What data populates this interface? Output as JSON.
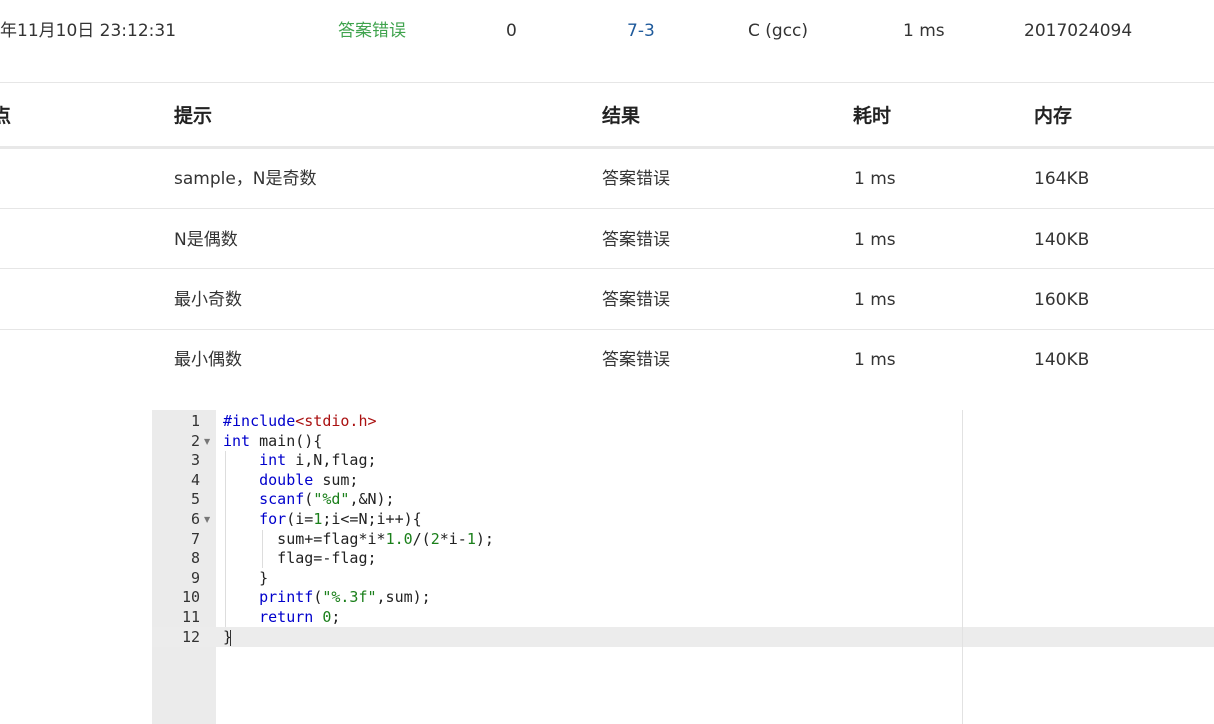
{
  "submission": {
    "time": "年11月10日 23:12:31",
    "status": "答案错误",
    "score": "0",
    "problem": "7-3",
    "compiler": "C (gcc)",
    "duration": "1 ms",
    "user": "2017024094"
  },
  "cases_table": {
    "headers": [
      "点",
      "提示",
      "结果",
      "耗时",
      "内存"
    ],
    "rows": [
      {
        "hint": "sample，N是奇数",
        "result": "答案错误",
        "time": "1 ms",
        "memory": "164KB"
      },
      {
        "hint": "N是偶数",
        "result": "答案错误",
        "time": "1 ms",
        "memory": "140KB"
      },
      {
        "hint": "最小奇数",
        "result": "答案错误",
        "time": "1 ms",
        "memory": "160KB"
      },
      {
        "hint": "最小偶数",
        "result": "答案错误",
        "time": "1 ms",
        "memory": "140KB"
      }
    ]
  },
  "editor": {
    "line_numbers": [
      "1",
      "2",
      "3",
      "4",
      "5",
      "6",
      "7",
      "8",
      "9",
      "10",
      "11",
      "12"
    ],
    "lines": [
      "#include<stdio.h>",
      "int main(){",
      "    int i,N,flag;",
      "    double sum;",
      "    scanf(\"%d\",&N);",
      "    for(i=1;i<=N;i++){",
      "      sum+=flag*i*1.0/(2*i-1);",
      "      flag=-flag;",
      "    }",
      "    printf(\"%.3f\",sum);",
      "    return 0;",
      "}"
    ]
  },
  "colors": {
    "result_error": "#3fa34d",
    "problem_link": "#1f5a9b",
    "keyword": "#0000cc",
    "string": "#1a7f1a"
  }
}
